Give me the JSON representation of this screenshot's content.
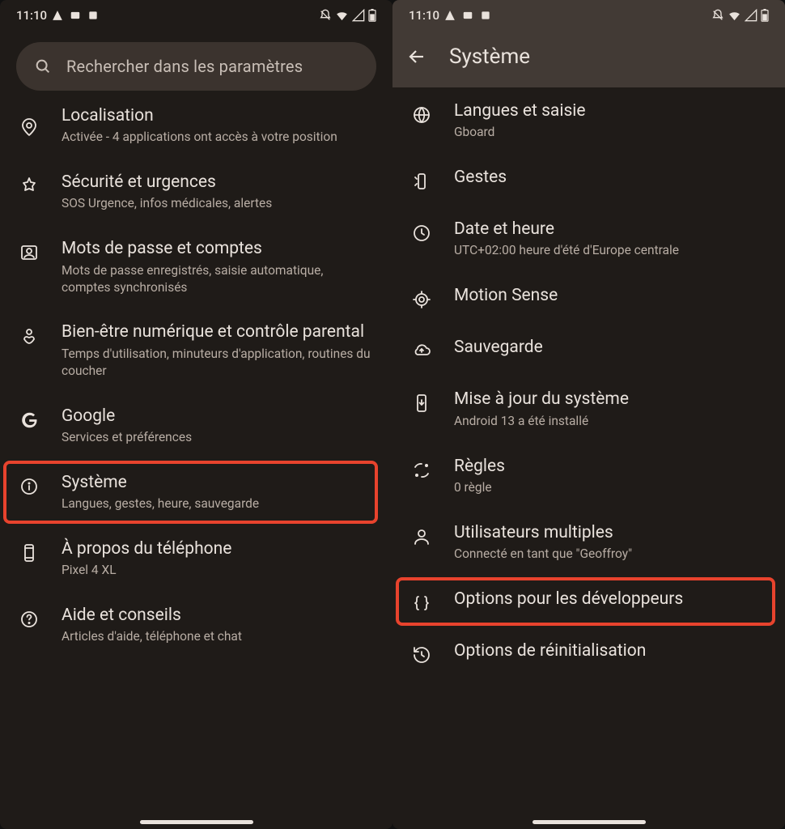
{
  "left": {
    "status": {
      "time": "11:10"
    },
    "search_placeholder": "Rechercher dans les paramètres",
    "highlight_index": 5,
    "items": [
      {
        "icon": "location",
        "title": "Localisation",
        "subtitle": "Activée - 4 applications ont accès à votre position"
      },
      {
        "icon": "emergency",
        "title": "Sécurité et urgences",
        "subtitle": "SOS Urgence, infos médicales, alertes"
      },
      {
        "icon": "account-box",
        "title": "Mots de passe et comptes",
        "subtitle": "Mots de passe enregistrés, saisie automatique, comptes synchronisés"
      },
      {
        "icon": "wellbeing",
        "title": "Bien-être numérique et contrôle parental",
        "subtitle": "Temps d'utilisation, minuteurs d'application, routines du coucher"
      },
      {
        "icon": "google-g",
        "title": "Google",
        "subtitle": "Services et préférences"
      },
      {
        "icon": "info",
        "title": "Système",
        "subtitle": "Langues, gestes, heure, sauvegarde"
      },
      {
        "icon": "phone-info",
        "title": "À propos du téléphone",
        "subtitle": "Pixel 4 XL"
      },
      {
        "icon": "help",
        "title": "Aide et conseils",
        "subtitle": "Articles d'aide, téléphone et chat"
      }
    ]
  },
  "right": {
    "status": {
      "time": "11:10"
    },
    "header_title": "Système",
    "highlight_index": 8,
    "items": [
      {
        "icon": "globe",
        "title": "Langues et saisie",
        "subtitle": "Gboard"
      },
      {
        "icon": "gesture-phone",
        "title": "Gestes",
        "subtitle": ""
      },
      {
        "icon": "clock",
        "title": "Date et heure",
        "subtitle": "UTC+02:00 heure d'été d'Europe centrale"
      },
      {
        "icon": "motion-sense",
        "title": "Motion Sense",
        "subtitle": ""
      },
      {
        "icon": "cloud-backup",
        "title": "Sauvegarde",
        "subtitle": ""
      },
      {
        "icon": "system-update",
        "title": "Mise à jour du système",
        "subtitle": "Android 13 a été installé"
      },
      {
        "icon": "rules",
        "title": "Règles",
        "subtitle": "0 règle"
      },
      {
        "icon": "users",
        "title": "Utilisateurs multiples",
        "subtitle": "Connecté en tant que \"Geoffroy\""
      },
      {
        "icon": "braces",
        "title": "Options pour les développeurs",
        "subtitle": ""
      },
      {
        "icon": "restore",
        "title": "Options de réinitialisation",
        "subtitle": ""
      }
    ]
  }
}
